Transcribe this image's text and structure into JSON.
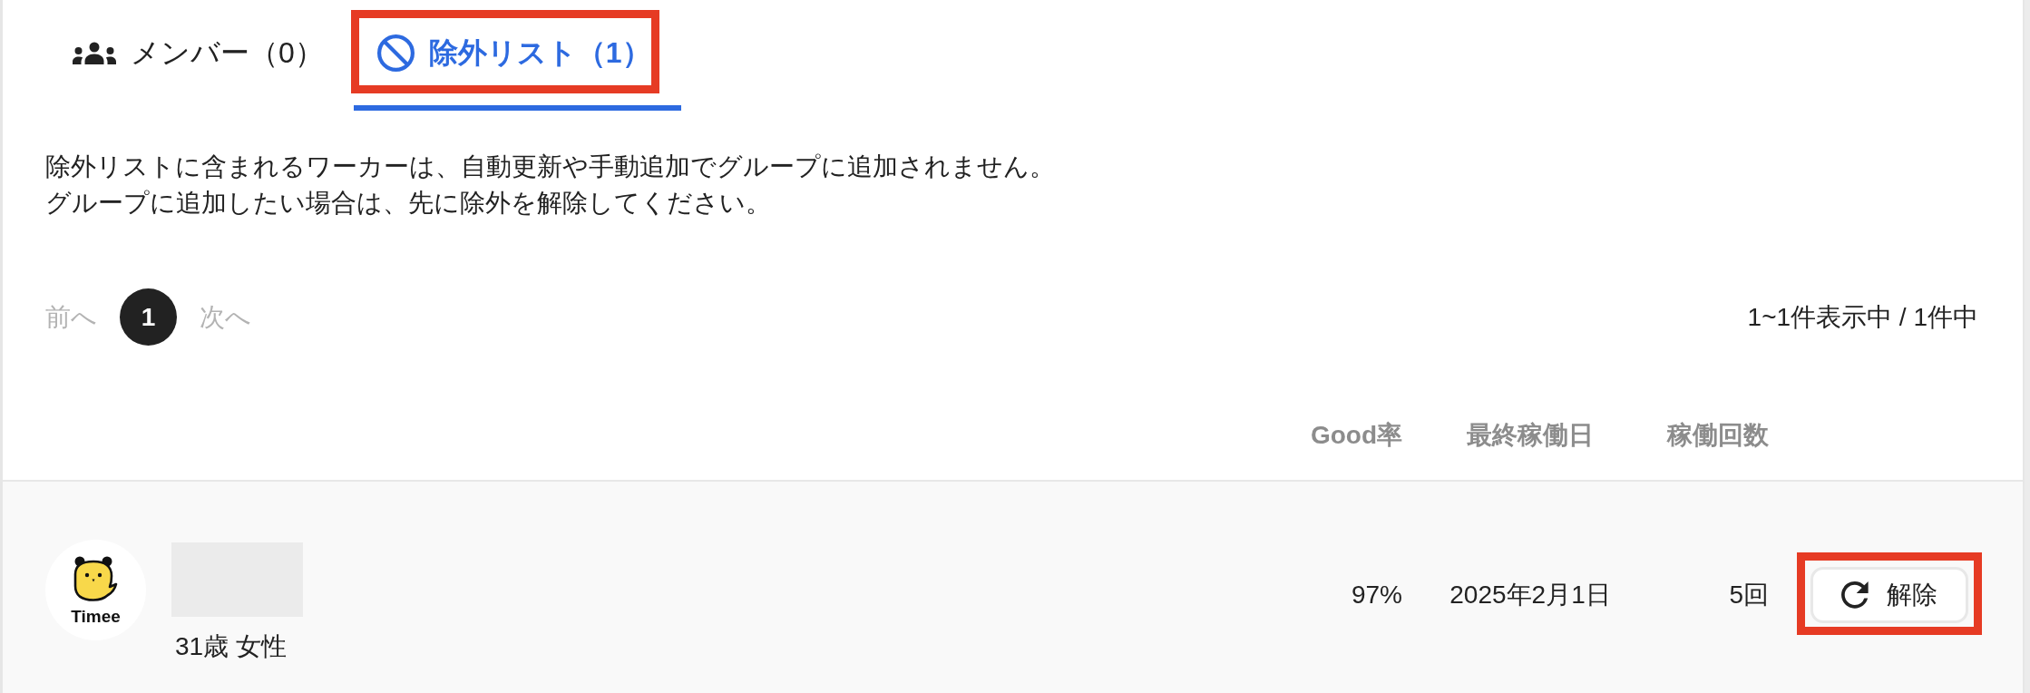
{
  "tabs": [
    {
      "kind": "members",
      "label": "メンバー（0）",
      "selected": false,
      "highlighted": false
    },
    {
      "kind": "excluded",
      "label": "除外リスト（1）",
      "selected": true,
      "highlighted": true
    }
  ],
  "description": [
    "除外リストに含まれるワーカーは、自動更新や手動追加でグループに追加されません。",
    "グループに追加したい場合は、先に除外を解除してください。"
  ],
  "pagination": {
    "prev": {
      "label": "前へ",
      "disabled": true
    },
    "pages": [
      {
        "label": "1",
        "selected": true
      }
    ],
    "next": {
      "label": "次へ",
      "disabled": true
    },
    "summary": "1~1件表示中 / 1件中"
  },
  "table": {
    "columns": [
      "Good率",
      "最終稼働日",
      "稼働回数"
    ],
    "rows": [
      {
        "avatar_logo": "Timee",
        "details": "31歳 女性",
        "good_rate": "97%",
        "last_worked": "2025年2月1日",
        "work_count": "5回",
        "action": {
          "label": "解除",
          "highlighted": true
        }
      }
    ]
  }
}
